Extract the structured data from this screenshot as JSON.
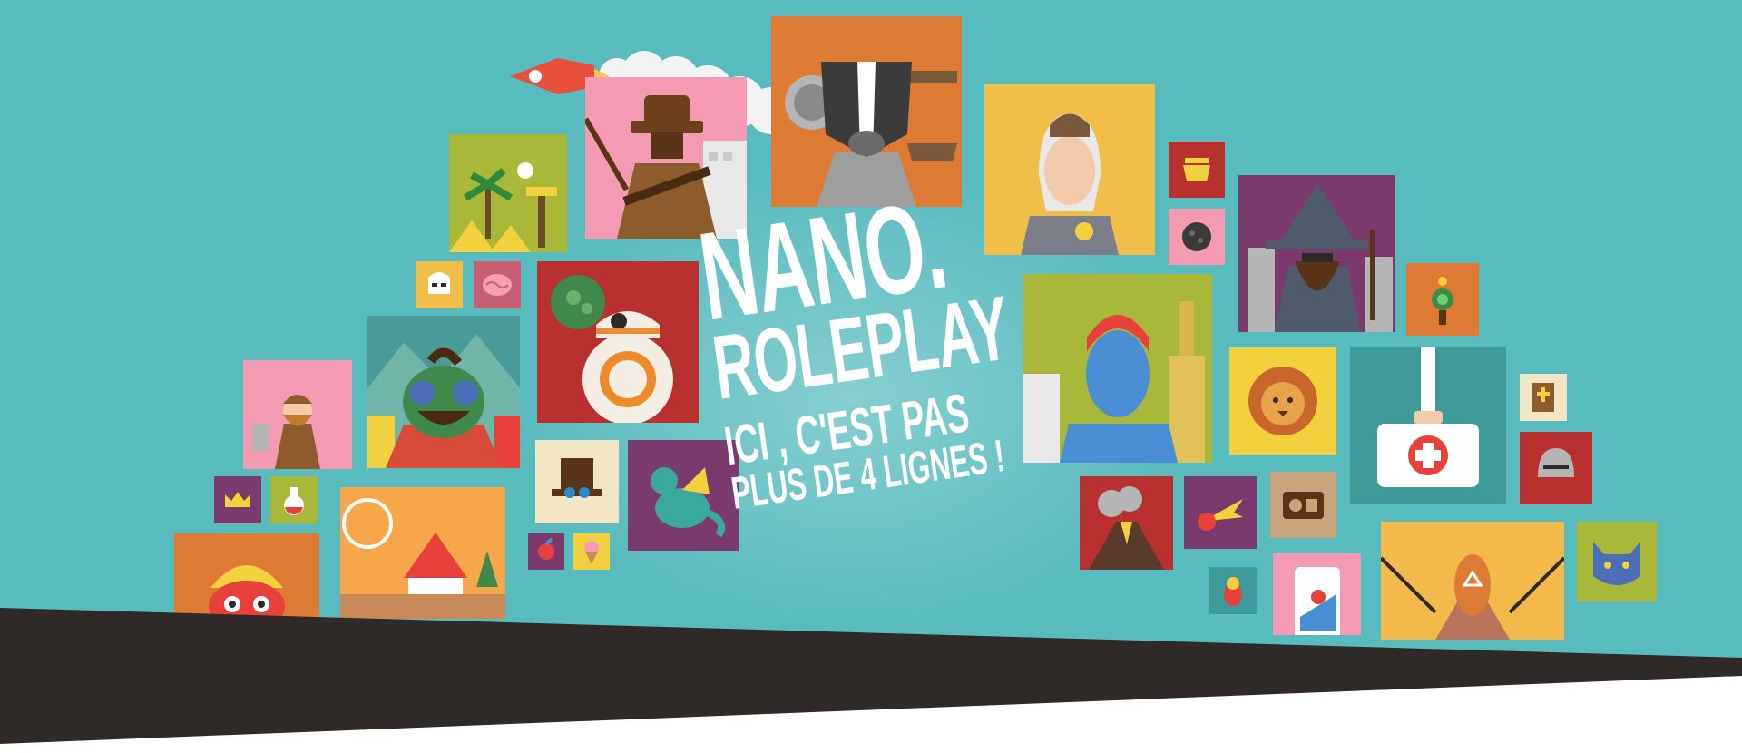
{
  "banner": {
    "title_line1": "NANO.",
    "title_line2": "ROLEPLAY",
    "tagline_line1": "ICI , C'EST PAS",
    "tagline_line2": "PLUS DE 4 LIGNES !"
  },
  "colors": {
    "background": "#58bbbe",
    "bottom_band": "#2f2a28",
    "text": "#ffffff"
  },
  "illustrations": [
    "rocket-icon",
    "cowboy-icon",
    "badger-icon",
    "woman-portrait-icon",
    "tropical-island-icon",
    "ghost-icon",
    "stormtrooper-icon",
    "brain-icon",
    "bb8-droid-icon",
    "blue-man-city-icon",
    "wizard-icon",
    "viking-icon",
    "troll-monster-icon",
    "crown-icon",
    "potion-icon",
    "top-hat-icon",
    "dragon-icon",
    "circus-icon",
    "tribal-mask-icon",
    "lion-icon",
    "first-aid-kit-icon",
    "bible-icon",
    "helmet-icon",
    "volcano-icon",
    "meteor-icon",
    "radio-icon",
    "doll-icon",
    "map-phone-icon",
    "ancient-astronaut-icon",
    "beast-icon",
    "pot-icon",
    "meatball-icon",
    "steampunk-device-icon",
    "bird-icon",
    "ice-cream-icon"
  ]
}
